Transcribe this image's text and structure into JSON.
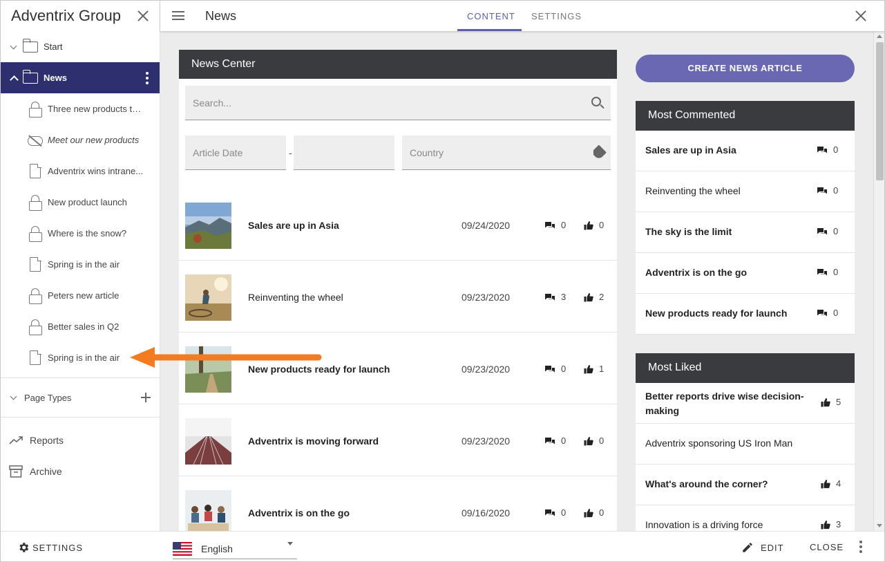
{
  "sidebar": {
    "title": "Adventrix Group",
    "tree": {
      "root_label": "Start",
      "active_label": "News",
      "children": [
        {
          "icon": "lock-icon",
          "label": "Three new products to..."
        },
        {
          "icon": "hidden-eye-icon",
          "label": "Meet our new products"
        },
        {
          "icon": "page-icon",
          "label": "Adventrix wins intrane..."
        },
        {
          "icon": "lock-icon",
          "label": "New product launch"
        },
        {
          "icon": "lock-icon",
          "label": "Where is the snow?"
        },
        {
          "icon": "page-icon",
          "label": "Spring is in the air"
        },
        {
          "icon": "lock-icon",
          "label": "Peters new article"
        },
        {
          "icon": "lock-icon",
          "label": "Better sales in Q2"
        },
        {
          "icon": "page-icon",
          "label": "Spring is in the air"
        }
      ]
    },
    "page_types_label": "Page Types",
    "nav": [
      {
        "icon": "trending-icon",
        "label": "Reports"
      },
      {
        "icon": "archive-icon",
        "label": "Archive"
      }
    ]
  },
  "topbar": {
    "page_name": "News",
    "tabs": [
      "CONTENT",
      "SETTINGS"
    ],
    "active_tab": "CONTENT"
  },
  "news_center": {
    "title": "News Center",
    "search_placeholder": "Search...",
    "date_placeholder": "Article Date",
    "date_separator": "-",
    "country_placeholder": "Country",
    "articles": [
      {
        "title": "Sales are up in Asia",
        "bold": true,
        "date": "09/24/2020",
        "comments": "0",
        "likes": "0",
        "thumb": "mountain-landscape"
      },
      {
        "title": "Reinventing the wheel",
        "bold": false,
        "date": "09/23/2020",
        "comments": "3",
        "likes": "2",
        "thumb": "person-in-field"
      },
      {
        "title": "New products ready for launch",
        "bold": true,
        "date": "09/23/2020",
        "comments": "0",
        "likes": "1",
        "thumb": "forest-path"
      },
      {
        "title": "Adventrix is moving forward",
        "bold": true,
        "date": "09/23/2020",
        "comments": "0",
        "likes": "0",
        "thumb": "running-track"
      },
      {
        "title": "Adventrix is on the go",
        "bold": true,
        "date": "09/16/2020",
        "comments": "0",
        "likes": "0",
        "thumb": "team-meeting"
      }
    ]
  },
  "create_button_label": "CREATE NEWS ARTICLE",
  "most_commented": {
    "title": "Most Commented",
    "items": [
      {
        "title": "Sales are up in Asia",
        "bold": true,
        "count": "0"
      },
      {
        "title": "Reinventing the wheel",
        "bold": false,
        "count": "0"
      },
      {
        "title": "The sky is the limit",
        "bold": true,
        "count": "0"
      },
      {
        "title": "Adventrix is on the go",
        "bold": true,
        "count": "0"
      },
      {
        "title": "New products ready for launch",
        "bold": true,
        "count": "0"
      }
    ]
  },
  "most_liked": {
    "title": "Most Liked",
    "items": [
      {
        "title": "Better reports drive wise decision-making",
        "bold": true,
        "count": "5"
      },
      {
        "title": "Adventrix sponsoring US Iron Man",
        "bold": false,
        "count": ""
      },
      {
        "title": "What's around the corner?",
        "bold": true,
        "count": "4"
      },
      {
        "title": "Innovation is a driving force",
        "bold": false,
        "count": "3"
      }
    ]
  },
  "bottombar": {
    "settings_label": "SETTINGS",
    "language": "English",
    "edit_label": "EDIT",
    "close_label": "CLOSE"
  },
  "colors": {
    "active_nav": "#2d2f6e",
    "accent": "#5c5ea6",
    "create_button": "#6b68b3",
    "panel_header": "#3a3b3e",
    "annotation_arrow": "#f47b20"
  }
}
